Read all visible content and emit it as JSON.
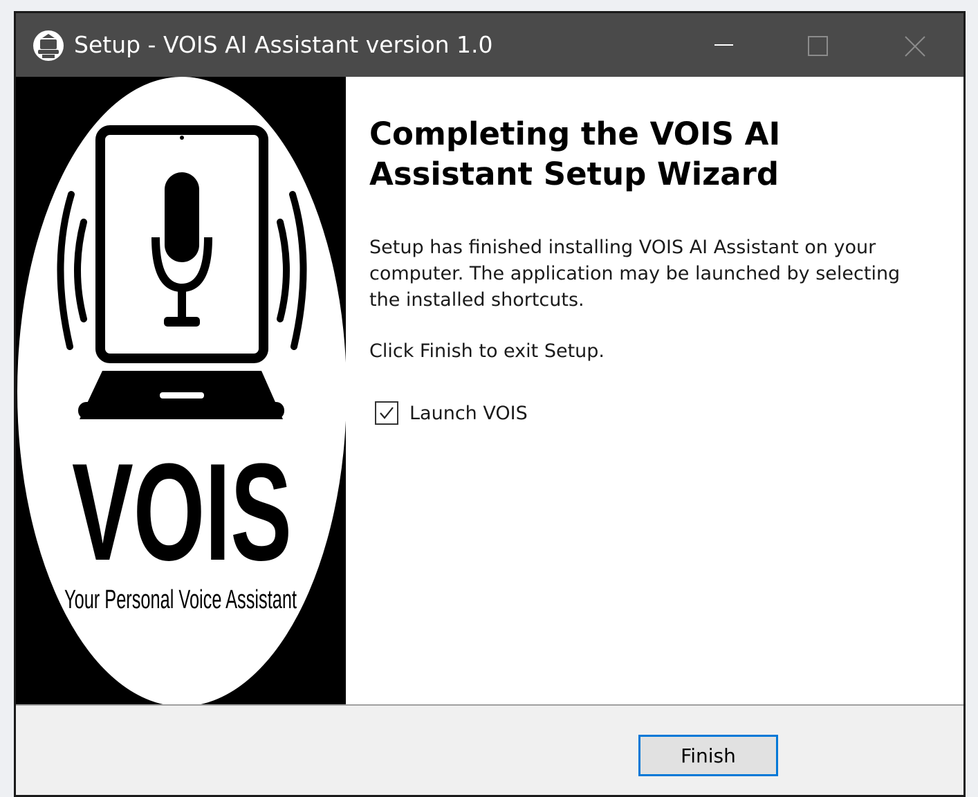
{
  "window": {
    "title": "Setup - VOIS AI Assistant version 1.0",
    "controls": {
      "minimize_icon": "minimize-icon",
      "maximize_icon": "maximize-icon",
      "close_icon": "close-icon"
    }
  },
  "side_panel": {
    "logo_text": "VOIS",
    "tagline": "Your Personal Voice Assistant"
  },
  "content": {
    "heading": "Completing the VOIS AI Assistant Setup Wizard",
    "paragraph_1": "Setup has finished installing VOIS AI Assistant on your computer. The application may be launched by selecting the installed shortcuts.",
    "paragraph_2": "Click Finish to exit Setup.",
    "launch_checkbox": {
      "label": "Launch VOIS",
      "checked": true
    }
  },
  "footer": {
    "finish_label": "Finish"
  },
  "colors": {
    "titlebar": "#4a4a4a",
    "focus_border": "#0078d7",
    "footer_bg": "#f0f0f0"
  }
}
